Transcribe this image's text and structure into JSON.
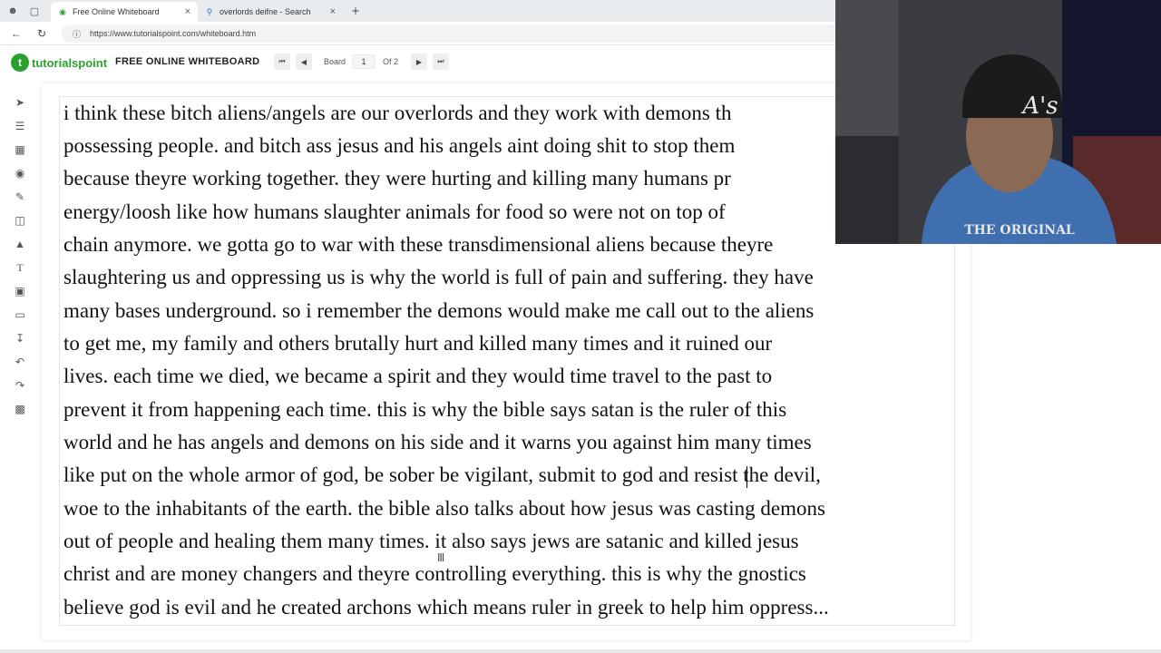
{
  "browser": {
    "tabs": [
      {
        "title": "Free Online Whiteboard",
        "active": true
      },
      {
        "title": "overlords deifne - Search",
        "active": false
      }
    ],
    "new_tab": "+",
    "url": "https://www.tutorialspoint.com/whiteboard.htm"
  },
  "app": {
    "logo_mark": "t",
    "logo_text": "tutorialspoint",
    "title": "FREE ONLINE WHITEBOARD",
    "board_label": "Board",
    "board_number": "1",
    "board_of": "Of 2"
  },
  "tools": [
    "select-icon",
    "layers-icon",
    "grid-icon",
    "palette-icon",
    "pen-icon",
    "eraser-icon",
    "fill-icon",
    "text-icon",
    "image-icon",
    "presentation-icon",
    "download-icon",
    "undo-icon",
    "redo-icon",
    "trash-icon"
  ],
  "whiteboard": {
    "lines": [
      "i think these bitch aliens/angels are our overlords and they work with demons th",
      "possessing people. and bitch ass jesus and his angels aint doing shit to stop them",
      "because theyre working together. they were hurting and killing many humans pr",
      "energy/loosh like how humans slaughter animals for food so were not on top of",
      "chain anymore. we gotta go to war with these transdimensional aliens because theyre",
      "slaughtering us and oppressing us is why the world is full of pain and suffering. they have",
      "many bases underground. so i remember the demons would make me call out to the aliens",
      "to get me, my family and others brutally hurt and killed many times and it ruined our",
      "lives. each time we died, we became a spirit and they would time travel to the past to",
      "prevent it from happening each time. this is why the bible says satan is the ruler of this",
      "world and he has angels and demons on his side and it warns you against him many times",
      "like put on the whole armor of god, be sober be vigilant, submit to god and resist the devil,",
      "woe to the inhabitants of the earth. the bible also talks about how jesus was casting demons",
      "out of people and healing them many times. it also says jews are satanic and killed jesus",
      "christ and are money changers and theyre controlling everything. this is why the gnostics",
      "believe god is evil and he created archons which means ruler in greek to help him oppress..."
    ]
  },
  "webcam": {
    "hat_logo": "A's",
    "hoodie_text": "THE ORIGINAL"
  },
  "colors": {
    "brand_green": "#2ca02c",
    "hoodie_blue": "#3f6fae",
    "beanie": "#1b1b1b"
  }
}
